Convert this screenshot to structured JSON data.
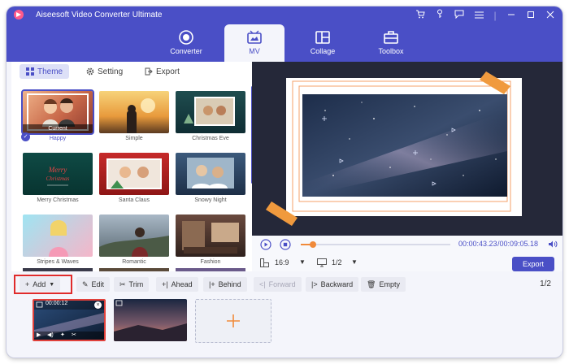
{
  "app": {
    "title": "Aiseesoft Video Converter Ultimate",
    "accent": "#4a4fc6"
  },
  "window_controls": [
    "cart-icon",
    "key-icon",
    "chat-icon",
    "menu-icon",
    "minimize-icon",
    "maximize-icon",
    "close-icon"
  ],
  "nav": {
    "items": [
      {
        "label": "Converter",
        "icon": "converter-icon"
      },
      {
        "label": "MV",
        "icon": "mv-icon",
        "active": true
      },
      {
        "label": "Collage",
        "icon": "collage-icon"
      },
      {
        "label": "Toolbox",
        "icon": "toolbox-icon"
      }
    ]
  },
  "tabs": {
    "theme": "Theme",
    "setting": "Setting",
    "export": "Export"
  },
  "themes": [
    {
      "label": "Happy",
      "badge": "Current",
      "selected": true
    },
    {
      "label": "Simple"
    },
    {
      "label": "Christmas Eve"
    },
    {
      "label": "Merry Christmas"
    },
    {
      "label": "Santa Claus"
    },
    {
      "label": "Snowy Night"
    },
    {
      "label": "Stripes & Waves"
    },
    {
      "label": "Romantic"
    },
    {
      "label": "Fashion"
    }
  ],
  "player": {
    "time_current": "00:00:43.23",
    "time_total": "/00:09:05.18",
    "progress": 0.08,
    "aspect": "16:9",
    "page": "1/2",
    "export_label": "Export"
  },
  "toolbar": {
    "add": "Add",
    "edit": "Edit",
    "trim": "Trim",
    "ahead": "Ahead",
    "behind": "Behind",
    "forward": "Forward",
    "backward": "Backward",
    "empty": "Empty",
    "page_count": "1/2"
  },
  "clips": [
    {
      "duration": "00:00:12"
    },
    {
      "duration": ""
    }
  ]
}
